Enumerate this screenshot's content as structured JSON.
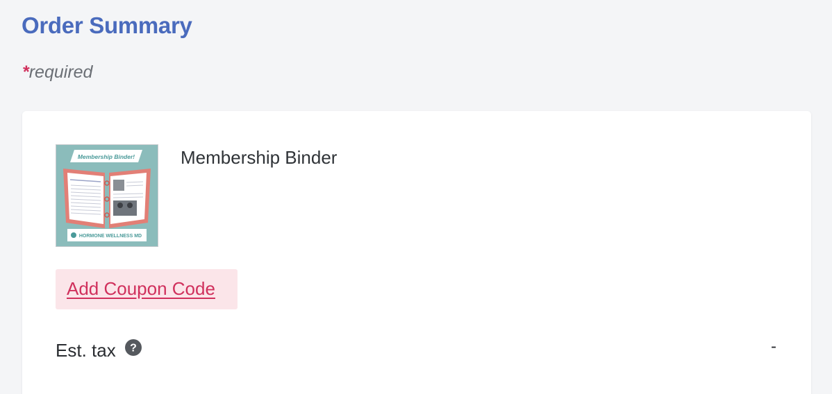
{
  "header": {
    "title": "Order Summary",
    "required_star": "*",
    "required_text": "required"
  },
  "product": {
    "name": "Membership Binder",
    "thumbnail_banner": "Membership Binder!",
    "thumbnail_brand": "HORMONE WELLNESS MD"
  },
  "coupon": {
    "label": "Add Coupon Code"
  },
  "tax": {
    "label": "Est. tax",
    "value": "-",
    "help_icon": "question-circle-icon"
  },
  "colors": {
    "title": "#4a6bbd",
    "accent": "#d0305c",
    "coupon_bg": "#fbe5e9",
    "thumbnail_bg": "#8bbcbb"
  }
}
